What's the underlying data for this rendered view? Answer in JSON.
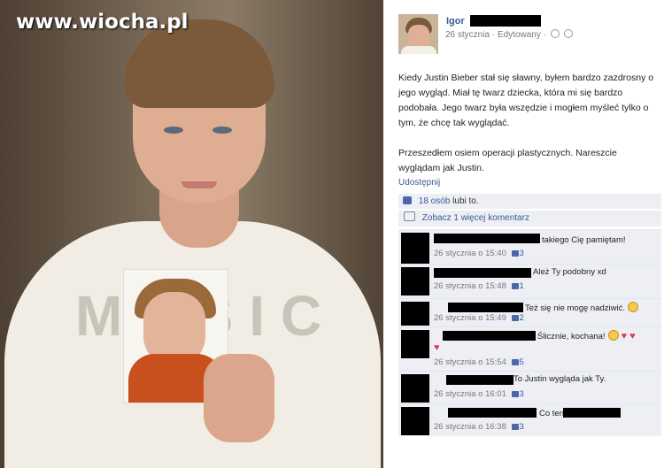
{
  "watermark": "www.wiocha.pl",
  "photo": {
    "shirt_text": "MUSIC"
  },
  "post": {
    "author": "Igor",
    "date": "26 stycznia",
    "separator": "·",
    "edited": "Edytowany",
    "paragraphs": [
      "Kiedy Justin Bieber stał się sławny, byłem bardzo zazdrosny o jego wygląd. Miał tę twarz dziecka, która mi się bardzo podobała. Jego twarz była wszędzie i mogłem myśleć tylko o tym, że chcę tak wyglądać.",
      "Przeszedłem osiem operacji plastycznych. Nareszcie wyglądam jak Justin."
    ],
    "share_label": "Udostępnij",
    "likes_link": "18 osób",
    "likes_suffix": "lubi to.",
    "more_comments": "Zobacz 1 więcej komentarz"
  },
  "comments": [
    {
      "text": "takiego Cię pamiętam!",
      "time": "26 stycznia o 15:40",
      "likes": "3"
    },
    {
      "text": "Ależ Ty podobny xd",
      "time": "26 stycznia o 15:48",
      "likes": "1"
    },
    {
      "text": "Też się nie mogę nadziwić.",
      "time": "26 stycznia o 15:49",
      "likes": "2"
    },
    {
      "text": "Ślicznie, kochana!",
      "time": "26 stycznia o 15:54",
      "likes": "5"
    },
    {
      "text": "To Justin wygląda jak Ty.",
      "time": "26 stycznia o 16:01",
      "likes": "3"
    },
    {
      "text": "Co ten",
      "time": "26 stycznia o 16:38",
      "likes": "3"
    }
  ],
  "colors": {
    "link": "#3b5998",
    "comment_bg": "#edeff4"
  }
}
